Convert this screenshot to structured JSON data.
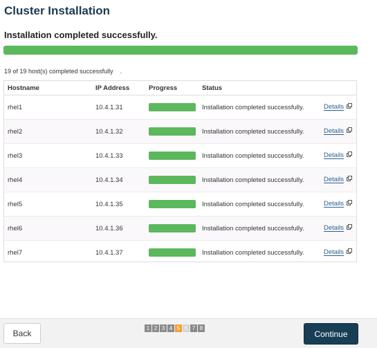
{
  "page": {
    "title": "Cluster Installation",
    "status_message": "Installation completed successfully.",
    "overall_progress": 1.0,
    "summary": "19 of 19 host(s) completed successfully",
    "summary_suffix": "."
  },
  "table": {
    "headers": {
      "hostname": "Hostname",
      "ip": "IP Address",
      "progress": "Progress",
      "status": "Status"
    },
    "rows": [
      {
        "hostname": "rhel1",
        "ip": "10.4.1.31",
        "progress": 1.0,
        "status": "Installation completed successfully.",
        "details": "Details"
      },
      {
        "hostname": "rhel2",
        "ip": "10.4.1.32",
        "progress": 1.0,
        "status": "Installation completed successfully.",
        "details": "Details"
      },
      {
        "hostname": "rhel3",
        "ip": "10.4.1.33",
        "progress": 1.0,
        "status": "Installation completed successfully.",
        "details": "Details"
      },
      {
        "hostname": "rhel4",
        "ip": "10.4.1.34",
        "progress": 1.0,
        "status": "Installation completed successfully.",
        "details": "Details"
      },
      {
        "hostname": "rhel5",
        "ip": "10.4.1.35",
        "progress": 1.0,
        "status": "Installation completed successfully.",
        "details": "Details"
      },
      {
        "hostname": "rhel6",
        "ip": "10.4.1.36",
        "progress": 1.0,
        "status": "Installation completed successfully.",
        "details": "Details"
      },
      {
        "hostname": "rhel7",
        "ip": "10.4.1.37",
        "progress": 1.0,
        "status": "Installation completed successfully.",
        "details": "Details"
      }
    ],
    "details_icon": "external-link-icon"
  },
  "footer": {
    "back_label": "Back",
    "continue_label": "Continue",
    "steps": [
      {
        "label": "1",
        "state": "done"
      },
      {
        "label": "2",
        "state": "done"
      },
      {
        "label": "3",
        "state": "done"
      },
      {
        "label": "4",
        "state": "done"
      },
      {
        "label": "5",
        "state": "active"
      },
      {
        "label": "6",
        "state": "future"
      },
      {
        "label": "7",
        "state": "done"
      },
      {
        "label": "8",
        "state": "done"
      }
    ]
  },
  "colors": {
    "progress_fill": "#5cb85c",
    "title": "#1d3a50",
    "primary_button": "#173e55",
    "active_step": "#f0a030",
    "link": "#2a5f8f"
  }
}
